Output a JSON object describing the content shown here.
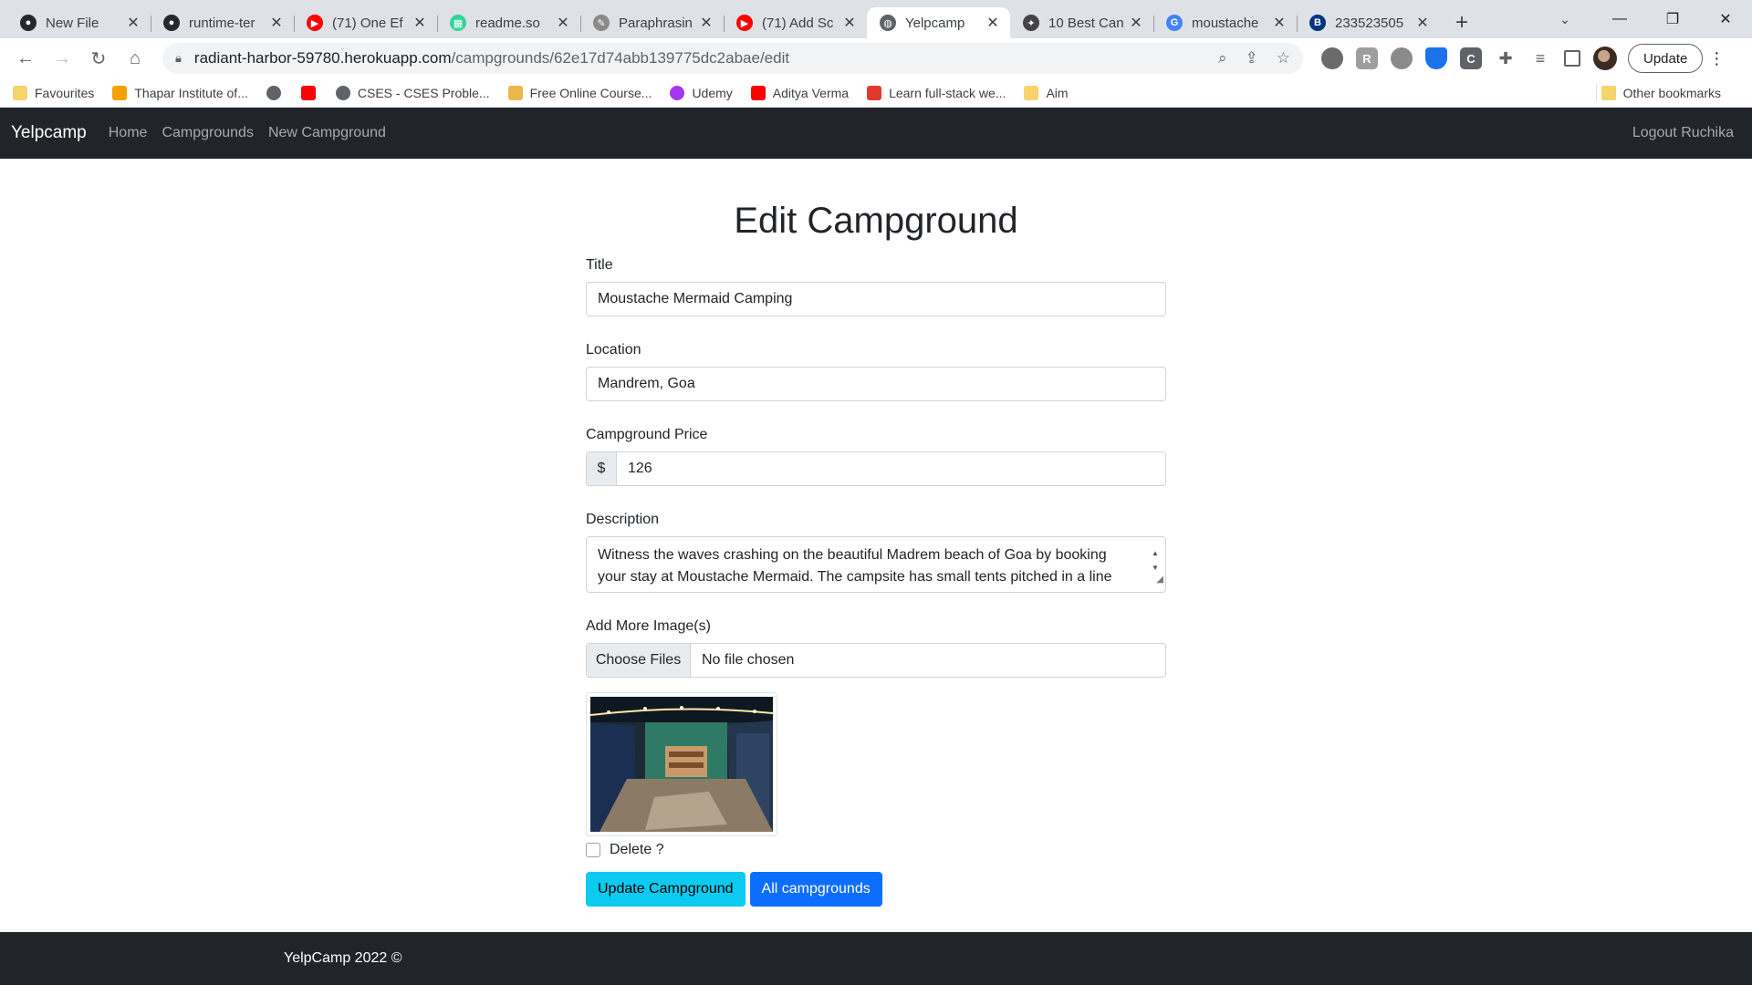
{
  "browser": {
    "tabs": [
      {
        "title": "New File",
        "icon": "github-icon",
        "color": "#24292f",
        "glyph": "●"
      },
      {
        "title": "runtime-ter",
        "icon": "github-icon",
        "color": "#24292f",
        "glyph": "●"
      },
      {
        "title": "(71) One Ef",
        "icon": "youtube-icon",
        "color": "#ff0000",
        "glyph": "▶"
      },
      {
        "title": "readme.so",
        "icon": "readme-icon",
        "color": "#34d399",
        "glyph": "▦"
      },
      {
        "title": "Paraphrasin",
        "icon": "quill-icon",
        "color": "#8a8a8a",
        "glyph": "✎"
      },
      {
        "title": "(71) Add Sc",
        "icon": "youtube-icon",
        "color": "#ff0000",
        "glyph": "▶"
      },
      {
        "title": "Yelpcamp",
        "icon": "globe-icon",
        "color": "#5f6368",
        "glyph": "◍",
        "active": true
      },
      {
        "title": "10 Best Can",
        "icon": "site-icon",
        "color": "#444444",
        "glyph": "✦"
      },
      {
        "title": "moustache",
        "icon": "google-icon",
        "color": "#4285f4",
        "glyph": "G"
      },
      {
        "title": "233523505",
        "icon": "booking-icon",
        "color": "#003580",
        "glyph": "B"
      }
    ],
    "new_tab": "+",
    "window": {
      "minimize": "—",
      "restore": "❐",
      "close": "✕",
      "tab_search": "⌄"
    },
    "nav": {
      "back": "←",
      "forward": "→",
      "reload": "↻",
      "home": "⌂"
    },
    "url": {
      "host": "radiant-harbor-59780.herokuapp.com",
      "path": "/campgrounds/62e17d74abb139775dc2abae/edit"
    },
    "update_label": "Update",
    "bookmarks": [
      {
        "label": "Favourites",
        "icon": "folder-icon"
      },
      {
        "label": "Thapar Institute of...",
        "icon": "thapar-icon"
      },
      {
        "label": "",
        "icon": "globe-icon"
      },
      {
        "label": "",
        "icon": "youtube-icon"
      },
      {
        "label": "CSES - CSES Proble...",
        "icon": "globe-icon"
      },
      {
        "label": "Free Online Course...",
        "icon": "course-icon"
      },
      {
        "label": "Udemy",
        "icon": "udemy-icon"
      },
      {
        "label": "Aditya Verma",
        "icon": "youtube-icon"
      },
      {
        "label": "Learn full-stack we...",
        "icon": "codecademy-icon"
      },
      {
        "label": "Aim",
        "icon": "folder-icon"
      }
    ],
    "other_bookmarks": "Other bookmarks"
  },
  "navbar": {
    "brand": "Yelpcamp",
    "links": [
      "Home",
      "Campgrounds",
      "New Campground"
    ],
    "logout": "Logout Ruchika"
  },
  "form": {
    "heading": "Edit Campground",
    "title_label": "Title",
    "title_value": "Moustache Mermaid Camping",
    "location_label": "Location",
    "location_value": "Mandrem, Goa",
    "price_label": "Campground Price",
    "currency": "$",
    "price_value": "126",
    "description_label": "Description",
    "description_value": "Witness the waves crashing on the beautiful Madrem beach of Goa by booking your stay at Moustache Mermaid. The campsite has small tents pitched in a line",
    "images_label": "Add More Image(s)",
    "choose_files": "Choose Files",
    "no_file": "No file chosen",
    "delete_label": "Delete ?",
    "update_button": "Update Campground",
    "all_button": "All campgrounds"
  },
  "footer": {
    "text": "YelpCamp 2022 ©"
  },
  "colors": {
    "navbar_bg": "#212529",
    "info": "#0dcaf0",
    "primary": "#0d6efd"
  }
}
